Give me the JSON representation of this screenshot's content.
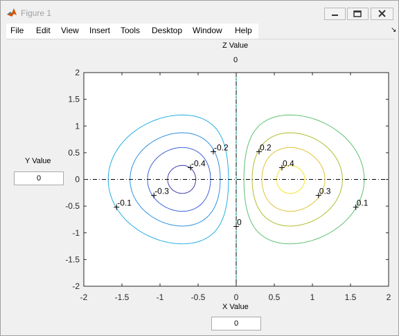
{
  "window": {
    "title": "Figure 1"
  },
  "menu": [
    "File",
    "Edit",
    "View",
    "Insert",
    "Tools",
    "Desktop",
    "Window",
    "Help"
  ],
  "controls": {
    "z_label": "Z Value",
    "z_value": "0",
    "y_label": "Y Value",
    "y_value": "0",
    "x_label": "X Value",
    "x_value": "0"
  },
  "chart_data": {
    "type": "contour",
    "xlim": [
      -2,
      2
    ],
    "ylim": [
      -2,
      2
    ],
    "x_ticks": [
      "-2",
      "-1.5",
      "-1",
      "-0.5",
      "0",
      "0.5",
      "1",
      "1.5",
      "2"
    ],
    "y_ticks": [
      "-2",
      "-1.5",
      "-1",
      "-0.5",
      "0",
      "0.5",
      "1",
      "1.5",
      "2"
    ],
    "grid": false,
    "crosshair": {
      "x": 0,
      "y": 0
    },
    "contour_labels": [
      {
        "text": "-0.1",
        "x": -1.57,
        "y": -0.52
      },
      {
        "text": "-0.2",
        "x": -0.3,
        "y": 0.52
      },
      {
        "text": "-0.3",
        "x": -1.08,
        "y": -0.3
      },
      {
        "text": "-0.4",
        "x": -0.6,
        "y": 0.22
      },
      {
        "text": "0",
        "x": 0.0,
        "y": -0.88
      },
      {
        "text": "0.1",
        "x": 1.57,
        "y": -0.52
      },
      {
        "text": "0.2",
        "x": 0.3,
        "y": 0.52
      },
      {
        "text": "0.3",
        "x": 1.08,
        "y": -0.3
      },
      {
        "text": "0.4",
        "x": 0.6,
        "y": 0.22
      }
    ],
    "levels": [
      {
        "value": -0.4,
        "color": "#3d3aa8"
      },
      {
        "value": -0.3,
        "color": "#3b60d8"
      },
      {
        "value": -0.2,
        "color": "#2b8fe0"
      },
      {
        "value": -0.1,
        "color": "#22aee0"
      },
      {
        "value": 0,
        "color": "#21b7a4"
      },
      {
        "value": 0.1,
        "color": "#5cc070"
      },
      {
        "value": 0.2,
        "color": "#b0bd2a"
      },
      {
        "value": 0.3,
        "color": "#e0c23a"
      },
      {
        "value": 0.4,
        "color": "#f3e528"
      }
    ]
  }
}
